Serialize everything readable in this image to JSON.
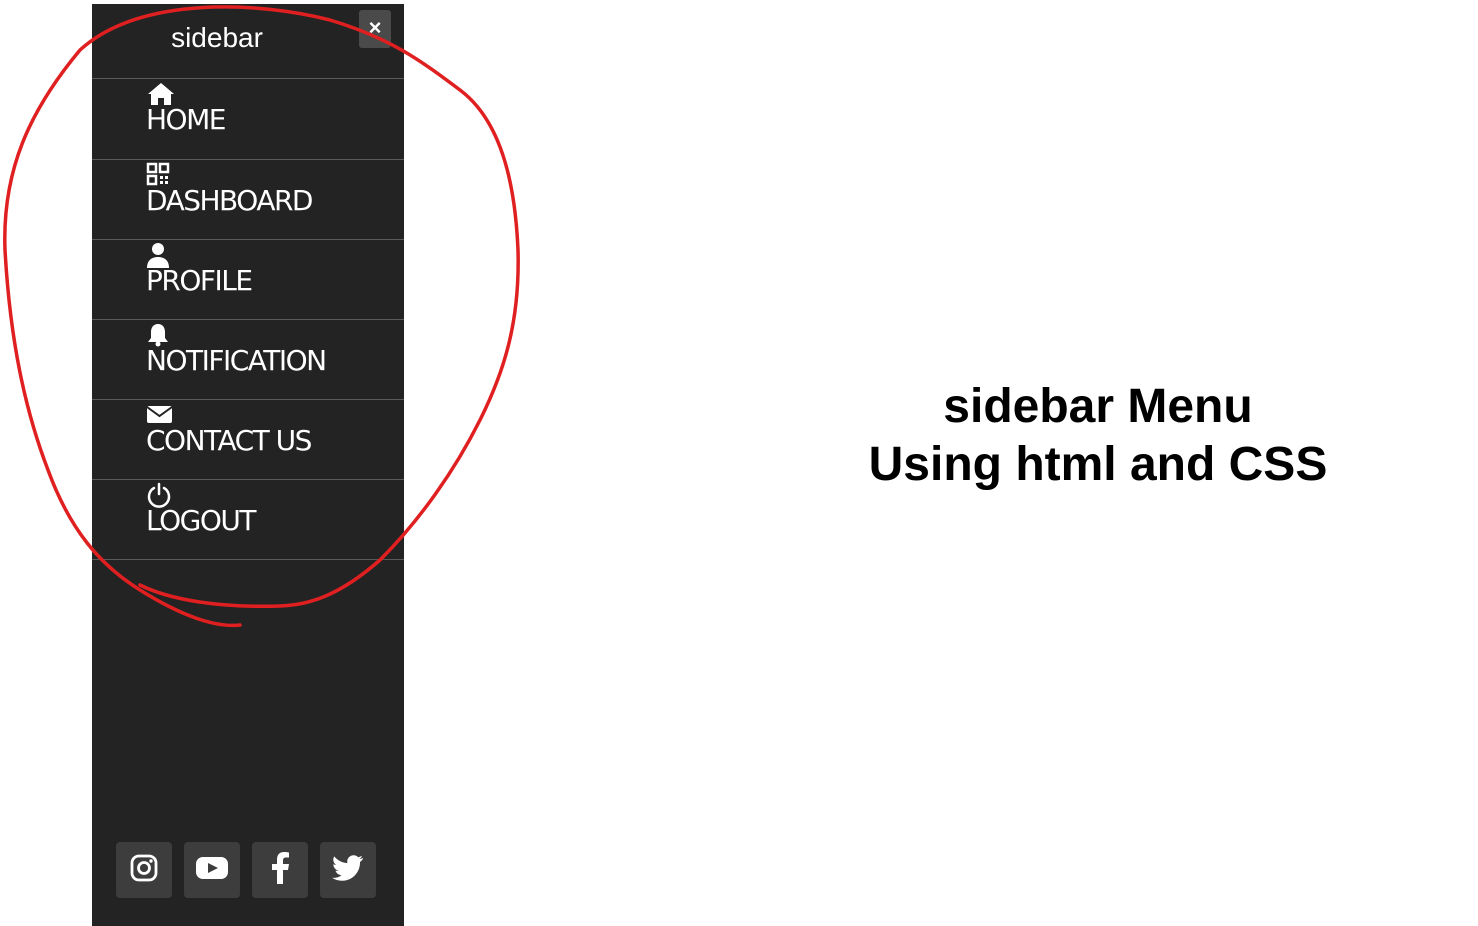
{
  "sidebar": {
    "title": "sidebar",
    "close_label": "×",
    "items": [
      {
        "label": "HOME",
        "icon": "home-icon"
      },
      {
        "label": "DASHBOARD",
        "icon": "qr-icon"
      },
      {
        "label": "PROFILE",
        "icon": "user-icon"
      },
      {
        "label": "NOTIFICATION",
        "icon": "bell-icon"
      },
      {
        "label": "CONTACT US",
        "icon": "envelope-icon"
      },
      {
        "label": "LOGOUT",
        "icon": "power-icon"
      }
    ],
    "social": [
      {
        "icon": "instagram-icon"
      },
      {
        "icon": "youtube-icon"
      },
      {
        "icon": "facebook-icon"
      },
      {
        "icon": "twitter-icon"
      }
    ]
  },
  "hero": {
    "line1": "sidebar Menu",
    "line2": "Using html and CSS"
  },
  "colors": {
    "sidebar_bg": "#232323",
    "annotation": "#e02020"
  }
}
